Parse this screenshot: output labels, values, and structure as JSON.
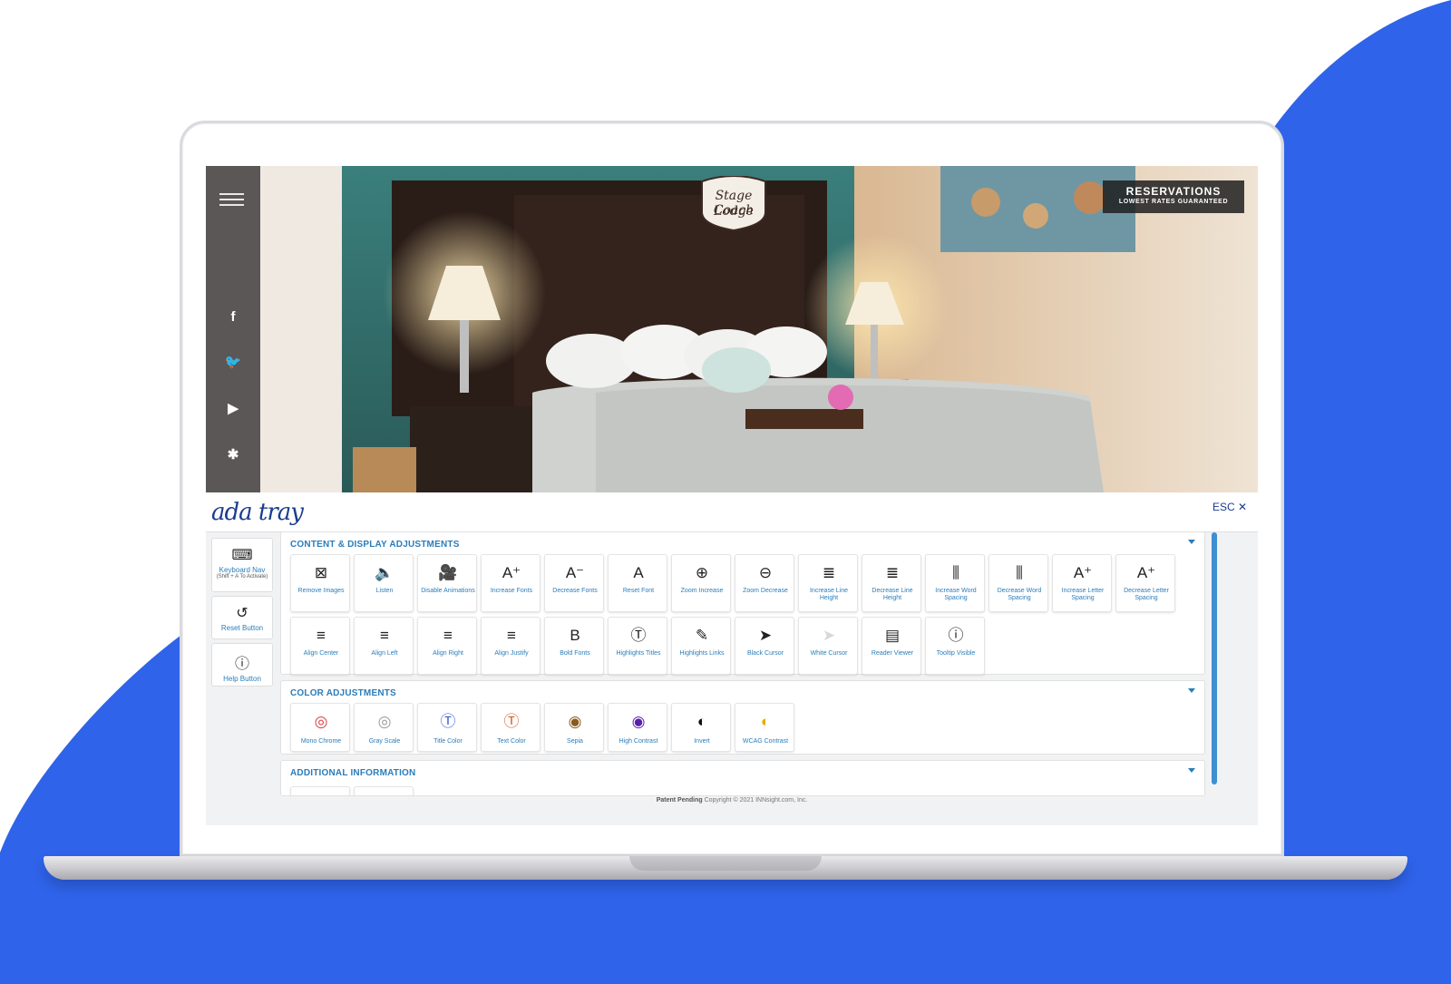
{
  "site": {
    "logo_line1": "Stage Coach",
    "logo_line2": "Lodge",
    "reservations_title": "RESERVATIONS",
    "reservations_sub": "LOWEST RATES GUARANTEED",
    "social": [
      "facebook-icon",
      "twitter-icon",
      "youtube-icon",
      "yelp-icon"
    ]
  },
  "tray": {
    "logo": "ada tray",
    "esc_label": "ESC ✕",
    "side_buttons": [
      {
        "icon": "keyboard-icon",
        "glyph": "⌨",
        "label": "Keyboard Nav",
        "sub": "(Shift + A To Activate)"
      },
      {
        "icon": "reset-icon",
        "glyph": "↺",
        "label": "Reset Button"
      },
      {
        "icon": "info-icon",
        "glyph": "ⓘ",
        "label": "Help Button"
      }
    ],
    "content_panel": {
      "title": "CONTENT & DISPLAY ADJUSTMENTS",
      "tiles": [
        {
          "glyph": "⊠",
          "label": "Remove Images"
        },
        {
          "glyph": "🔈",
          "label": "Listen"
        },
        {
          "glyph": "🎥",
          "label": "Disable Animations"
        },
        {
          "glyph": "A⁺",
          "label": "Increase Fonts"
        },
        {
          "glyph": "A⁻",
          "label": "Decrease Fonts"
        },
        {
          "glyph": "A",
          "label": "Reset Font"
        },
        {
          "glyph": "⊕",
          "label": "Zoom Increase"
        },
        {
          "glyph": "⊖",
          "label": "Zoom Decrease"
        },
        {
          "glyph": "≣",
          "label": "Increase Line Height"
        },
        {
          "glyph": "≣",
          "label": "Decrease Line Height"
        },
        {
          "glyph": "⫼",
          "label": "Increase Word Spacing"
        },
        {
          "glyph": "⫼",
          "label": "Decrease Word Spacing"
        },
        {
          "glyph": "A⁺",
          "label": "Increase Letter Spacing"
        },
        {
          "glyph": "A⁺",
          "label": "Decrease Letter Spacing"
        },
        {
          "glyph": "≡",
          "label": "Align Center"
        },
        {
          "glyph": "≡",
          "label": "Align Left"
        },
        {
          "glyph": "≡",
          "label": "Align Right"
        },
        {
          "glyph": "≡",
          "label": "Align Justify"
        },
        {
          "glyph": "B",
          "label": "Bold Fonts"
        },
        {
          "glyph": "Ⓣ",
          "label": "Highlights Titles"
        },
        {
          "glyph": "✎",
          "label": "Highlights Links"
        },
        {
          "glyph": "➤",
          "label": "Black Cursor"
        },
        {
          "glyph": "➤",
          "label": "White Cursor",
          "dim": true
        },
        {
          "glyph": "▤",
          "label": "Reader Viewer"
        },
        {
          "glyph": "ⓘ",
          "label": "Tooltip Visible"
        }
      ]
    },
    "color_panel": {
      "title": "COLOR ADJUSTMENTS",
      "tiles": [
        {
          "glyph": "◎",
          "label": "Mono Chrome",
          "color": "#d94040"
        },
        {
          "glyph": "◎",
          "label": "Gray Scale",
          "color": "#999999"
        },
        {
          "glyph": "Ⓣ",
          "label": "Title Color",
          "color": "#3a5fd1"
        },
        {
          "glyph": "Ⓣ",
          "label": "Text Color",
          "color": "#d95c2a"
        },
        {
          "glyph": "◉",
          "label": "Sepia",
          "color": "#8a5a1e"
        },
        {
          "glyph": "◉",
          "label": "High Contrast",
          "color": "#5b1fb0"
        },
        {
          "glyph": "◐",
          "label": "Invert",
          "color": "#111111"
        },
        {
          "glyph": "◐",
          "label": "WCAG Contrast",
          "color": "#e0b000"
        }
      ]
    },
    "additional_panel": {
      "title": "ADDITIONAL INFORMATION"
    },
    "footer_bold": "Patent Pending",
    "footer_text": " Copyright © 2021 INNsight.com, Inc."
  },
  "colors": {
    "accent_blue": "#2f63ea",
    "tray_blue": "#2a7dba"
  }
}
